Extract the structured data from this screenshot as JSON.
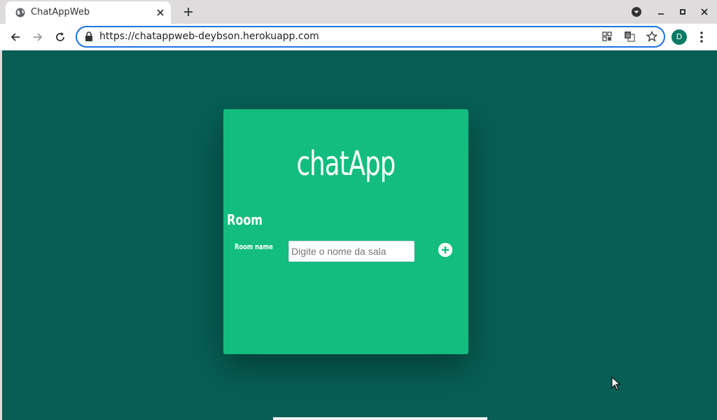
{
  "browser": {
    "tab_title": "ChatAppWeb",
    "url": "https://chatappweb-deybson.herokuapp.com",
    "profile_initial": "D"
  },
  "app": {
    "logo": "chatApp",
    "room_heading": "Room",
    "room_label": "Room name",
    "room_input_value": "",
    "room_input_placeholder": "Digite o nome da sala"
  },
  "colors": {
    "page_background": "#075e54",
    "card_background": "#12bd7f",
    "omnibox_focus": "#1a73e8"
  }
}
